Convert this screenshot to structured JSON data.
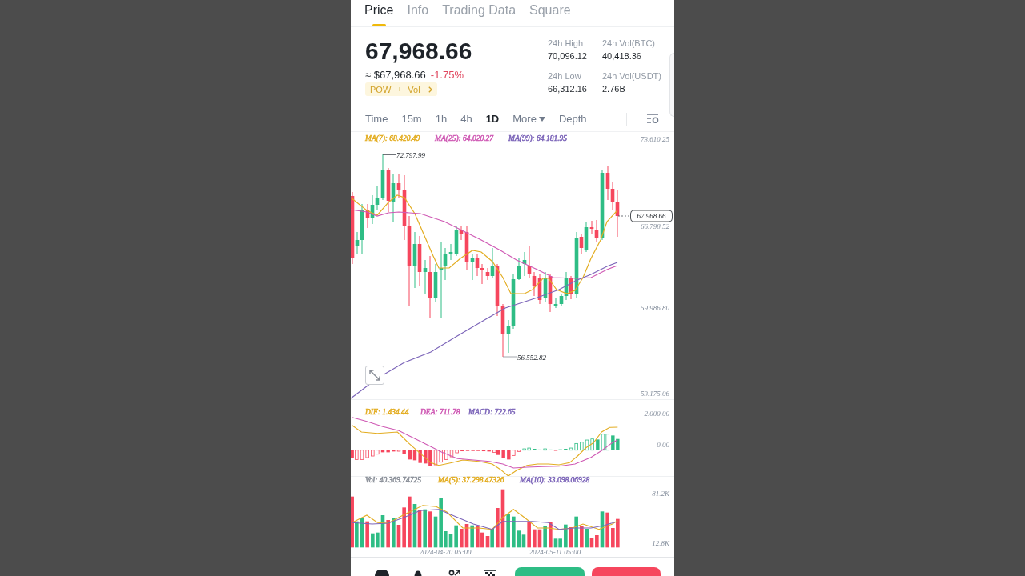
{
  "tabs": [
    {
      "label": "Price",
      "selected": true
    },
    {
      "label": "Info",
      "selected": false
    },
    {
      "label": "Trading Data",
      "selected": false
    },
    {
      "label": "Square",
      "selected": false
    }
  ],
  "ticker": {
    "price": "67,968.66",
    "fiat_price": "≈ $67,968.66",
    "change": "-1.75%",
    "tags": [
      "POW",
      "Vol"
    ],
    "stats": [
      {
        "label": "24h High",
        "value": "70,096.12"
      },
      {
        "label": "24h Vol(BTC)",
        "value": "40,418.36"
      },
      {
        "label": "24h Low",
        "value": "66,312.16"
      },
      {
        "label": "24h Vol(USDT)",
        "value": "2.76B"
      }
    ]
  },
  "intervals": [
    {
      "label": "Time",
      "kind": "option",
      "selected": false
    },
    {
      "label": "15m",
      "kind": "option",
      "selected": false
    },
    {
      "label": "1h",
      "kind": "option",
      "selected": false
    },
    {
      "label": "4h",
      "kind": "option",
      "selected": false
    },
    {
      "label": "1D",
      "kind": "option",
      "selected": true
    },
    {
      "label": "More",
      "kind": "dropdown",
      "selected": false
    },
    {
      "label": "Depth",
      "kind": "option",
      "selected": false
    }
  ],
  "price_chart": {
    "legend": [
      {
        "label": "MA(7): 68.420.49",
        "color": "#e3ad22"
      },
      {
        "label": "MA(25): 64.020.27",
        "color": "#cf59b4"
      },
      {
        "label": "MA(99): 64.181.95",
        "color": "#7c65b9"
      }
    ],
    "axis_labels": [
      "73.610.25",
      "66.798.52",
      "59.986.80",
      "53.175.06"
    ],
    "high_label": "72.797.99",
    "low_label": "56.552.82",
    "last_price": "67.968.66"
  },
  "macd_chart": {
    "legend": [
      {
        "label": "DIF: 1.434.44",
        "color": "#e3ad22"
      },
      {
        "label": "DEA: 711.78",
        "color": "#cf59b4"
      },
      {
        "label": "MACD: 722.65",
        "color": "#7c65b9"
      }
    ],
    "axis_labels": [
      "2.000.00",
      "0.00"
    ]
  },
  "volume_chart": {
    "legend": [
      {
        "label": "Vol: 40.369.74725",
        "color": "#8a8f98"
      },
      {
        "label": "MA(5): 37.298.47326",
        "color": "#e3ad22"
      },
      {
        "label": "MA(10): 33.098.06928",
        "color": "#7c65b9"
      }
    ],
    "axis_labels": [
      "81.2K",
      "12.8K"
    ],
    "dates": [
      "2024-04-20 05:00",
      "2024-05-11 05:00"
    ]
  }
}
